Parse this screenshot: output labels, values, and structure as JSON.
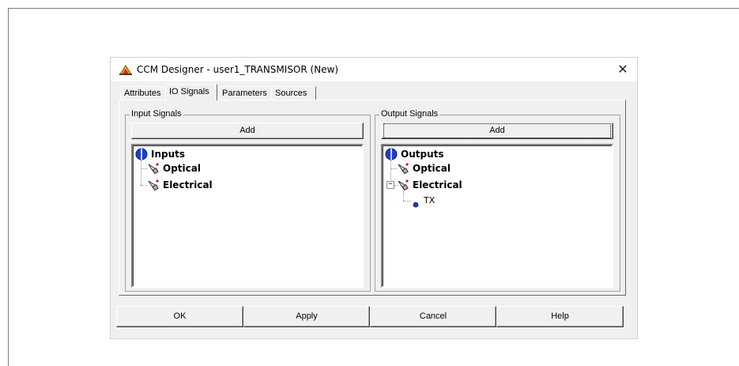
{
  "window": {
    "title": "CCM Designer - user1_TRANSMISOR (New)",
    "close_glyph": "✕"
  },
  "tabs": [
    {
      "label": "Attributes",
      "active": false
    },
    {
      "label": "IO Signals",
      "active": true
    },
    {
      "label": "Parameters",
      "active": false
    },
    {
      "label": "Sources",
      "active": false
    }
  ],
  "input_signals": {
    "group_label": "Input Signals",
    "add_label": "Add",
    "tree": {
      "root": "Inputs",
      "children": [
        "Optical",
        "Electrical"
      ]
    }
  },
  "output_signals": {
    "group_label": "Output Signals",
    "add_label": "Add",
    "tree": {
      "root": "Outputs",
      "children": [
        "Optical",
        "Electrical"
      ],
      "electrical_expanded_glyph": "−",
      "electrical_children": [
        "TX"
      ]
    }
  },
  "buttons": {
    "ok": "OK",
    "apply": "Apply",
    "cancel": "Cancel",
    "help": "Help"
  },
  "icons": {
    "app": "ccm-designer-app-icon",
    "root": "io-root-icon",
    "signal": "signal-connector-icon",
    "leaf": "signal-leaf-dot-icon"
  },
  "colors": {
    "dialog_bg": "#f0f0f0",
    "root_icon_blue": "#1e40c8",
    "leaf_dot": "#1e3fa8"
  }
}
